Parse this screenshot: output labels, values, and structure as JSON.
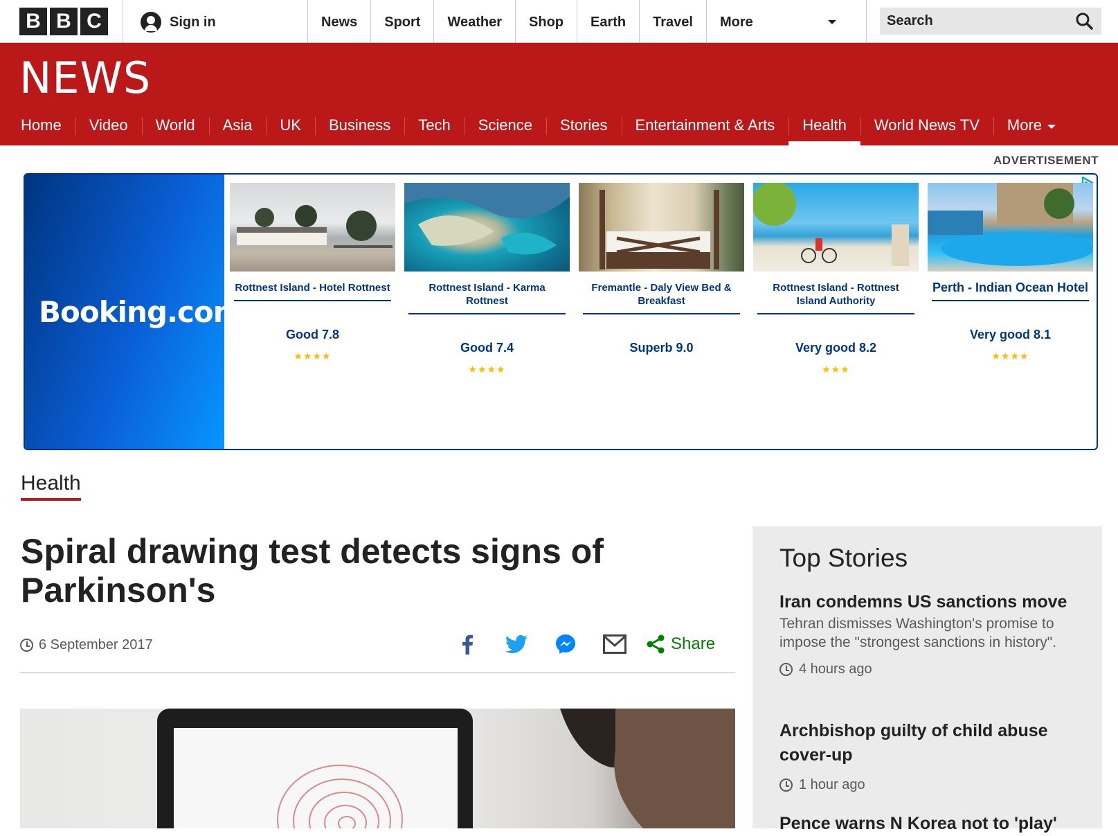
{
  "global_nav": {
    "logo": [
      "B",
      "B",
      "C"
    ],
    "sign_in": "Sign in",
    "items": [
      "News",
      "Sport",
      "Weather",
      "Shop",
      "Earth",
      "Travel",
      "More"
    ],
    "search_placeholder": "Search"
  },
  "masthead": {
    "title": "NEWS"
  },
  "news_nav": {
    "items": [
      "Home",
      "Video",
      "World",
      "Asia",
      "UK",
      "Business",
      "Tech",
      "Science",
      "Stories",
      "Entertainment & Arts",
      "Health",
      "World News TV"
    ],
    "more": "More",
    "active": "Health"
  },
  "advert": {
    "label": "ADVERTISEMENT",
    "brand": "Booking.com",
    "hotels": [
      {
        "name": "Rottnest Island - Hotel Rottnest",
        "score": "Good 7.8",
        "stars": "★★★★"
      },
      {
        "name": "Rottnest Island - Karma Rottnest",
        "score": "Good 7.4",
        "stars": "★★★★"
      },
      {
        "name": "Fremantle - Daly View Bed & Breakfast",
        "score": "Superb 9.0",
        "stars": ""
      },
      {
        "name": "Rottnest Island - Rottnest Island Authority",
        "score": "Very good 8.2",
        "stars": "★★★"
      },
      {
        "name": "Perth - Indian Ocean Hotel",
        "score": "Very good 8.1",
        "stars": "★★★★"
      }
    ]
  },
  "article": {
    "section": "Health",
    "headline": "Spiral drawing test detects signs of Parkinson's",
    "date": "6 September 2017",
    "share_label": "Share",
    "share_icons": [
      "facebook-icon",
      "twitter-icon",
      "messenger-icon",
      "email-icon",
      "share-icon"
    ]
  },
  "top_stories": {
    "heading": "Top Stories",
    "stories": [
      {
        "title": "Iran condemns US sanctions move",
        "summary": "Tehran dismisses Washington's promise to impose the \"strongest sanctions in history\".",
        "time": "4 hours ago"
      },
      {
        "title": "Archbishop guilty of child abuse cover-up",
        "summary": "",
        "time": "1 hour ago"
      },
      {
        "title": "Pence warns N Korea not to 'play'",
        "summary": "",
        "time": ""
      }
    ]
  },
  "colors": {
    "bbc_red": "#bb1919",
    "booking_blue": "#003580",
    "share_green": "#007f00",
    "star_yellow": "#febb02"
  }
}
